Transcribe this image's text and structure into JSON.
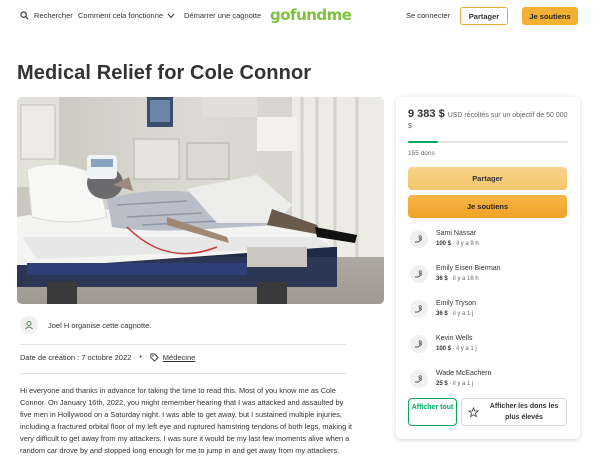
{
  "header": {
    "search_label": "Rechercher",
    "how_label": "Comment cela fonctionne",
    "start_label": "Démarrer une cagnotte",
    "logo_text": "gofundme",
    "login_label": "Se connecter",
    "share_label": "Partager",
    "donate_label": "Je soutiens"
  },
  "campaign": {
    "title": "Medical Relief for Cole Connor",
    "organizer": "Joel H organise cette cagnotte.",
    "created": "Date de création : 7 octobre 2022",
    "category": "Médecine",
    "story": "Hi everyone and thanks in advance for taking the time to read this. Most of you know me as Cole Connor. On January 16th, 2022, you might remember hearing that I was attacked and assaulted by five men in Hollywood on a Saturday night. I was able to get away, but I sustained multiple injuries, including a fractured orbital floor of my left eye and ruptured hamstring tendons of both legs, making it very difficult to get away from my attackers. I was sure it would be my last few moments alive when a random car drove by and stopped long enough for me to jump in and get away from my attackers."
  },
  "sidebar": {
    "raised_amount": "9 383 $",
    "raised_text": "USD récoltés sur un objectif de 50 000 $",
    "progress_fraction": 0.188,
    "donor_count": "155 dons",
    "share_label": "Partager",
    "donate_label": "Je soutiens",
    "donations": [
      {
        "name": "Sami Nassar",
        "amount": "100 $",
        "time": "il y a 9 h"
      },
      {
        "name": "Emily Eisen Bierman",
        "amount": "36 $",
        "time": "il y a 16 h"
      },
      {
        "name": "Emily Tryson",
        "amount": "36 $",
        "time": "il y a 1 j"
      },
      {
        "name": "Kevin Wells",
        "amount": "100 $",
        "time": "il y a 1 j"
      },
      {
        "name": "Wade McEachern",
        "amount": "25 $",
        "time": "il y a 1 j"
      }
    ],
    "see_all_label": "Afficher tout",
    "top_donations_label": "Afficher les dons les plus élevés"
  },
  "colors": {
    "brand_green": "#02a95c",
    "logo_green": "#7ec23b",
    "donate_orange": "#f2b134"
  }
}
